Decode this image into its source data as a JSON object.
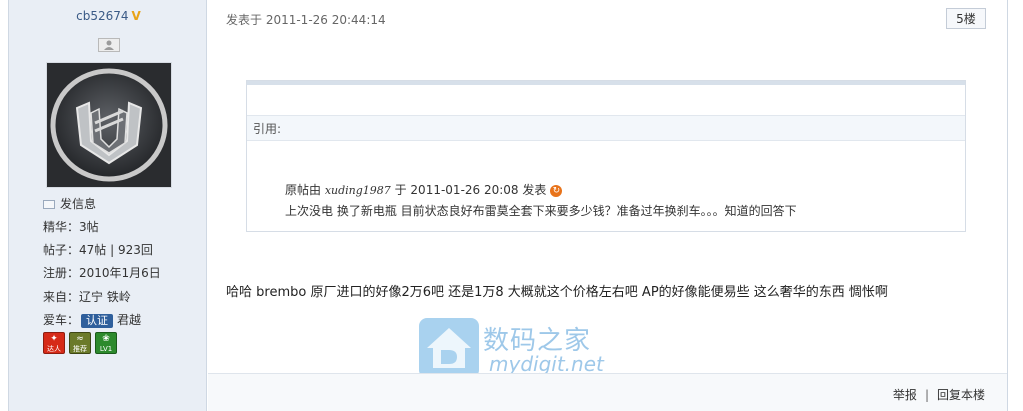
{
  "author": {
    "name": "cb52674",
    "badge": "V",
    "send_message": "发信息",
    "stats": {
      "jinghua": "精华：3帖",
      "posts": "帖子：47帖 | 923回",
      "registered": "注册：2010年1月6日",
      "from": "来自：辽宁 铁岭",
      "car_label": "爱车：",
      "cert": "认证",
      "car": "君越"
    },
    "medals": [
      {
        "icon": "daren-medal-icon",
        "text": "达人"
      },
      {
        "icon": "tuijian-medal-icon",
        "text": "推荐"
      },
      {
        "icon": "lv1-medal-icon",
        "text": "LV1"
      }
    ]
  },
  "post": {
    "time": "发表于 2011-1-26 20:44:14",
    "floor": "5楼",
    "quote": {
      "header": "引用:",
      "prefix": "原帖由 ",
      "author": "xuding1987",
      "suffix": " 于 2011-01-26 20:08 发表",
      "text": "上次没电 换了新电瓶 目前状态良好布雷莫全套下来要多少钱？准备过年换刹车。。。知道的回答下"
    },
    "body": "哈哈  brembo 原厂进口的好像2万6吧 还是1万8 大概就这个价格左右吧  AP的好像能便易些  这么奢华的东西 惆怅啊",
    "watermark": {
      "cn": "数码之家",
      "en": "mydigit.net"
    },
    "footer": {
      "report": "举报",
      "separator": "|",
      "reply": "回复本楼"
    }
  },
  "colors": {
    "sidebar_bg": "#e9eef5",
    "link": "#3a5a86",
    "accent": "#e8731a"
  }
}
